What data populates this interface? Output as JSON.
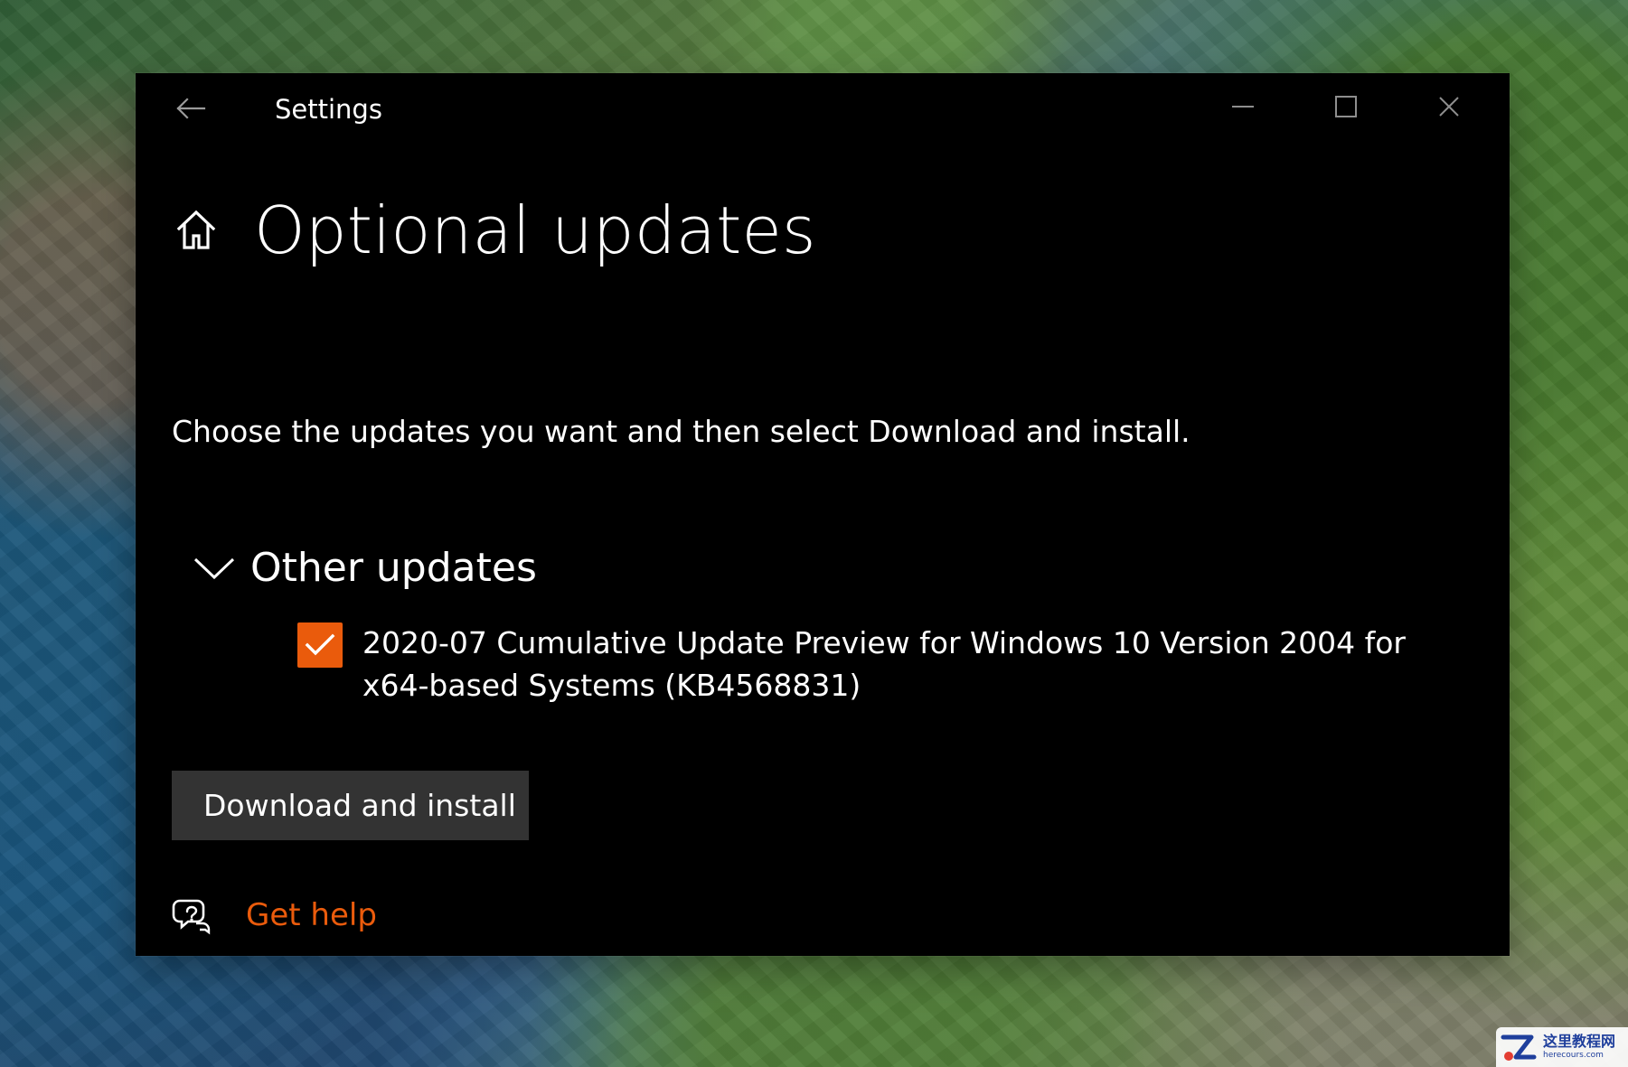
{
  "window": {
    "title": "Settings",
    "controls": {
      "back_icon": "back-arrow-icon",
      "minimize_icon": "minimize-icon",
      "maximize_icon": "maximize-icon",
      "close_icon": "close-icon"
    }
  },
  "page": {
    "home_icon": "home-icon",
    "title": "Optional updates",
    "description": "Choose the updates you want and then select Download and install."
  },
  "group": {
    "chevron_icon": "chevron-down-icon",
    "title": "Other updates",
    "items": [
      {
        "checked": true,
        "text": "2020-07 Cumulative Update Preview for Windows 10 Version 2004 for x64-based Systems (KB4568831)"
      }
    ]
  },
  "actions": {
    "download_button_label": "Download and install"
  },
  "help": {
    "icon": "help-chat-icon",
    "link_label": "Get help"
  },
  "watermark": {
    "cn": "这里教程网",
    "en": "herecours.com"
  },
  "colors": {
    "window_bg": "#000000",
    "text": "#FFFFFF",
    "accent": "#EA5B0C",
    "button_bg": "#333333"
  }
}
